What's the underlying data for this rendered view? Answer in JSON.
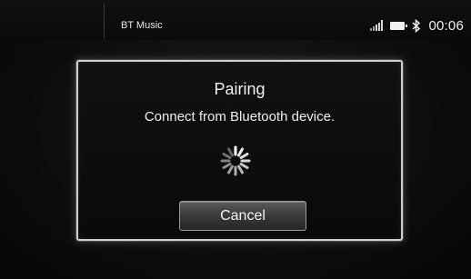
{
  "status_bar": {
    "app_title": "BT Music",
    "clock": "00:06",
    "icons": [
      "signal-icon",
      "battery-icon",
      "bluetooth-icon"
    ]
  },
  "dialog": {
    "title": "Pairing",
    "message": "Connect from Bluetooth device.",
    "spinner_icon": "loading-spinner-icon",
    "cancel_label": "Cancel"
  }
}
